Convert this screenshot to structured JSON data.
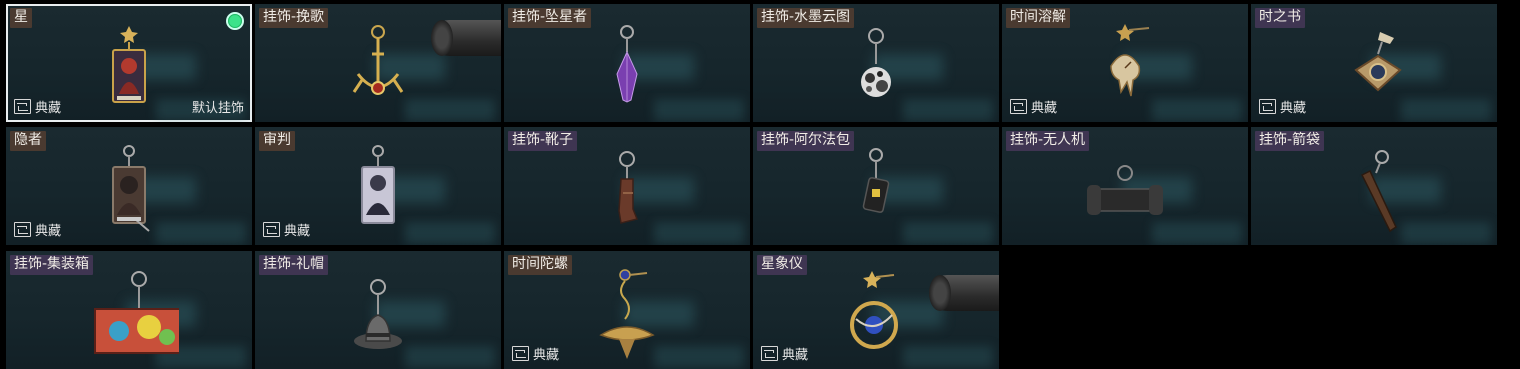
{
  "cards": [
    {
      "label": "星",
      "style": "brown",
      "collect": "典藏",
      "default_label": "默认挂饰",
      "selected": true,
      "equipped": true,
      "icon": "tarot-card-charm"
    },
    {
      "label": "挂饰-挽歌",
      "style": "brown",
      "icon": "golden-anchor-charm"
    },
    {
      "label": "挂饰-坠星者",
      "style": "brown",
      "icon": "purple-crystal-charm"
    },
    {
      "label": "挂饰-水墨云图",
      "style": "brown",
      "icon": "ink-cloud-orb-charm"
    },
    {
      "label": "时间溶解",
      "style": "brown",
      "collect": "典藏",
      "icon": "melting-clock-charm"
    },
    {
      "label": "时之书",
      "style": "purple",
      "collect": "典藏",
      "icon": "time-book-charm"
    },
    {
      "label": "隐者",
      "style": "brown",
      "collect": "典藏",
      "icon": "hermit-tarot-charm"
    },
    {
      "label": "审判",
      "style": "brown",
      "collect": "典藏",
      "icon": "judgement-tarot-charm"
    },
    {
      "label": "挂饰-靴子",
      "style": "purple",
      "icon": "boot-charm"
    },
    {
      "label": "挂饰-阿尔法包",
      "style": "purple",
      "icon": "alpha-bag-charm"
    },
    {
      "label": "挂饰-无人机",
      "style": "purple",
      "icon": "drone-charm"
    },
    {
      "label": "挂饰-箭袋",
      "style": "purple",
      "icon": "quiver-charm"
    },
    {
      "label": "挂饰-集装箱",
      "style": "purple",
      "icon": "container-charm"
    },
    {
      "label": "挂饰-礼帽",
      "style": "purple",
      "icon": "top-hat-charm"
    },
    {
      "label": "时间陀螺",
      "style": "brown",
      "collect": "典藏",
      "icon": "spinning-top-charm"
    },
    {
      "label": "星象仪",
      "style": "purple",
      "collect": "典藏",
      "icon": "astrolabe-charm"
    }
  ]
}
